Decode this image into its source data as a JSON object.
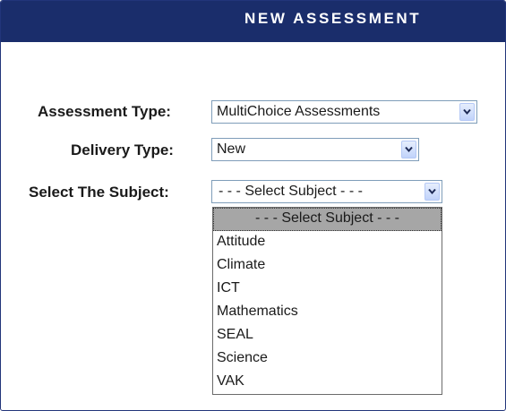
{
  "header": {
    "title": "NEW ASSESSMENT"
  },
  "form": {
    "assessment_type": {
      "label": "Assessment Type:",
      "value": "MultiChoice Assessments"
    },
    "delivery_type": {
      "label": "Delivery Type:",
      "value": "New"
    },
    "subject": {
      "label": "Select The Subject:",
      "value": "- - - Select Subject - - -",
      "options": [
        "- - - Select Subject - - -",
        "Attitude",
        "Climate",
        "ICT",
        "Mathematics",
        "SEAL",
        "Science",
        "VAK"
      ],
      "highlighted_index": 0
    }
  },
  "colors": {
    "header_bg": "#1a2d6b",
    "header_text": "#ffffff",
    "highlight_bg": "#a6a6a6"
  },
  "icons": {
    "dropdown_button": "chevron-down-icon"
  }
}
